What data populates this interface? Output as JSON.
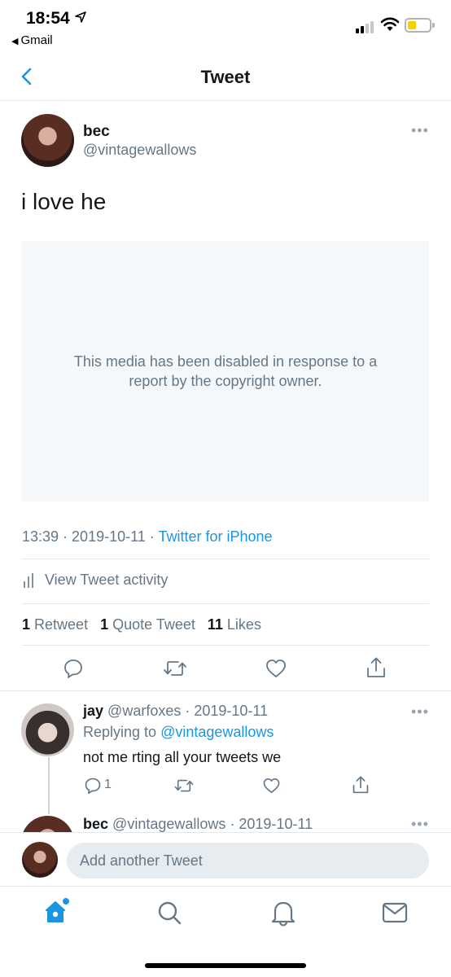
{
  "status_bar": {
    "time": "18:54",
    "back_app": "Gmail"
  },
  "header": {
    "title": "Tweet"
  },
  "tweet": {
    "author_name": "bec",
    "author_handle": "@vintagewallows",
    "text": "i love he",
    "media_notice": "This media has been disabled in response to a report by the copyright owner.",
    "time": "13:39",
    "date": "2019-10-11",
    "client": "Twitter for iPhone",
    "activity_label": "View Tweet activity",
    "retweets_count": "1",
    "retweets_label": "Retweet",
    "quotes_count": "1",
    "quotes_label": "Quote Tweet",
    "likes_count": "11",
    "likes_label": "Likes"
  },
  "reply": {
    "author_name": "jay",
    "author_handle": "@warfoxes",
    "date": "2019-10-11",
    "replying_prefix": "Replying to",
    "replying_to": "@vintagewallows",
    "text": "not me rting all your tweets we",
    "reply_count": "1"
  },
  "reply2": {
    "author_name": "bec",
    "author_handle": "@vintagewallows",
    "date": "2019-10-11"
  },
  "compose": {
    "placeholder": "Add another Tweet"
  },
  "tabs": [
    "home-icon",
    "search-icon",
    "notifications-bell-icon",
    "messages-envelope-icon"
  ],
  "colors": {
    "accent": "#1b95e0",
    "secondary_text": "#657786",
    "divider": "#e1e8ed",
    "battery_low": "#f5d100"
  }
}
